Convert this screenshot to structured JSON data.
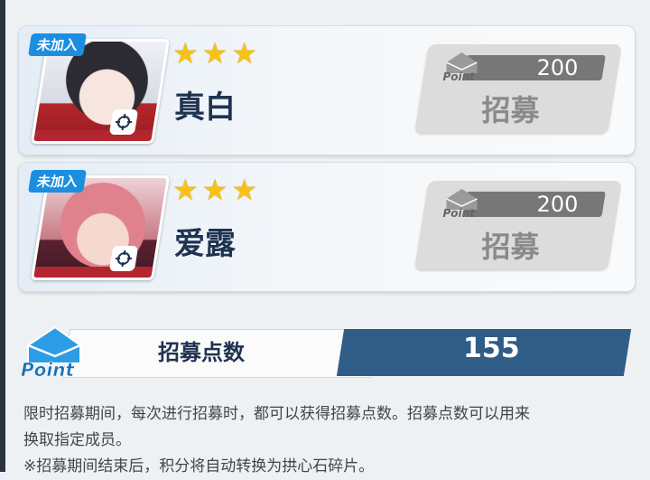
{
  "recruit_list": [
    {
      "badge": "未加入",
      "stars": 3,
      "name": "真白",
      "cost": "200",
      "button_label": "招募",
      "point_text": "Point"
    },
    {
      "badge": "未加入",
      "stars": 3,
      "name": "爱露",
      "cost": "200",
      "button_label": "招募",
      "point_text": "Point"
    }
  ],
  "points": {
    "icon_text": "Point",
    "label": "招募点数",
    "value": "155"
  },
  "description": {
    "line1": "限时招募期间，每次进行招募时，都可以获得招募点数。招募点数可以用来",
    "line2": "换取指定成员。",
    "line3": "※招募期间结束后，积分将自动转换为拱心石碎片。"
  },
  "colors": {
    "accent_blue": "#1b8ee0",
    "panel_dark_blue": "#2f5d86",
    "star_gold": "#f6c21a",
    "button_gray": "#dcdcdc"
  }
}
